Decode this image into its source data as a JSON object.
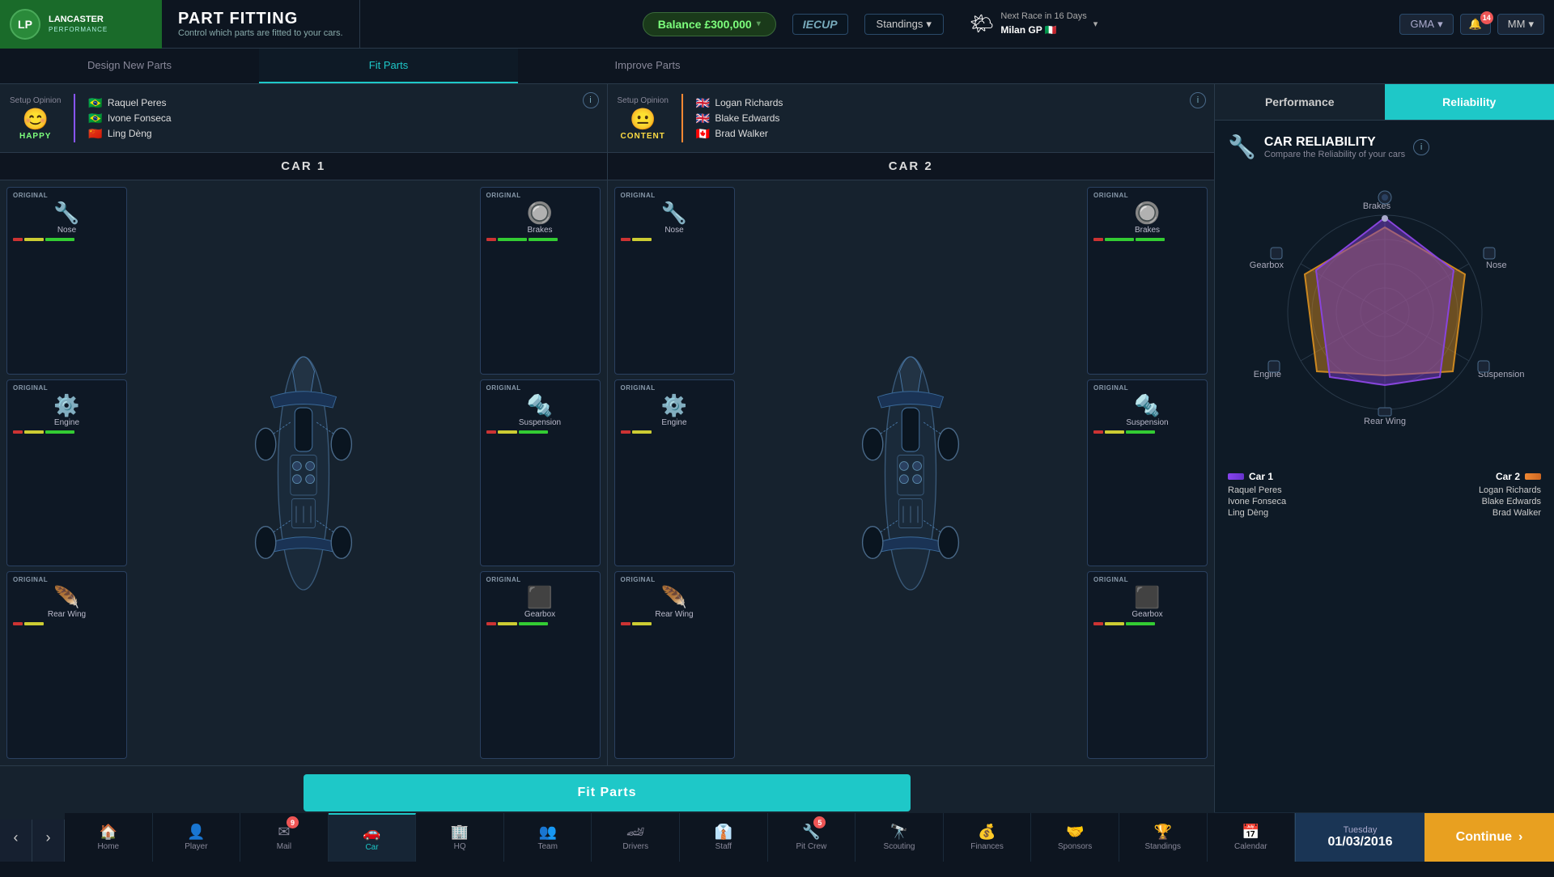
{
  "app": {
    "logo_initials": "LP",
    "logo_name": "LANCASTER",
    "logo_sub": "PERFORMANCE",
    "page_title": "PART FITTING",
    "page_subtitle": "Control which parts are fitted to your cars."
  },
  "topbar": {
    "balance_label": "Balance £300,000",
    "balance_arrow": "▾",
    "iecup": "IECUP",
    "standings": "Standings",
    "standings_arrow": "▾",
    "weather_icon": "🌤",
    "next_race_label": "Next Race in 16 Days",
    "next_race": "Milan GP 🇮🇹",
    "next_race_arrow": "▾",
    "gma": "GMA",
    "gma_arrow": "▾",
    "notif_count": "14",
    "user": "MM",
    "user_arrow": "▾"
  },
  "car1": {
    "label": "CAR 1",
    "setup_label": "Setup Opinion",
    "mood_icon": "😊",
    "mood": "HAPPY",
    "drivers": [
      {
        "flag": "🇧🇷",
        "name": "Raquel Peres"
      },
      {
        "flag": "🇧🇷",
        "name": "Ivone Fonseca"
      },
      {
        "flag": "🇨🇳",
        "name": "Ling Dèng"
      }
    ],
    "parts_left": [
      {
        "badge": "ORIGINAL",
        "icon": "🔧",
        "name": "Nose",
        "icon_char": "nose"
      },
      {
        "badge": "ORIGINAL",
        "icon": "⚙",
        "name": "Engine",
        "icon_char": "engine"
      },
      {
        "badge": "ORIGINAL",
        "icon": "🦅",
        "name": "Rear Wing",
        "icon_char": "rear_wing"
      }
    ],
    "parts_right": [
      {
        "badge": "ORIGINAL",
        "icon": "🔄",
        "name": "Brakes",
        "icon_char": "brakes"
      },
      {
        "badge": "ORIGINAL",
        "icon": "🔩",
        "name": "Suspension",
        "icon_char": "suspension"
      },
      {
        "badge": "ORIGINAL",
        "icon": "⬛",
        "name": "Gearbox",
        "icon_char": "gearbox"
      }
    ]
  },
  "car2": {
    "label": "CAR 2",
    "setup_label": "Setup Opinion",
    "mood_icon": "😐",
    "mood": "CONTENT",
    "drivers": [
      {
        "flag": "🇬🇧",
        "name": "Logan Richards"
      },
      {
        "flag": "🇬🇧",
        "name": "Blake Edwards"
      },
      {
        "flag": "🇨🇦",
        "name": "Brad Walker"
      }
    ],
    "parts_left": [
      {
        "badge": "ORIGINAL",
        "icon": "🔧",
        "name": "Nose",
        "icon_char": "nose"
      },
      {
        "badge": "ORIGINAL",
        "icon": "⚙",
        "name": "Engine",
        "icon_char": "engine"
      },
      {
        "badge": "ORIGINAL",
        "icon": "🦅",
        "name": "Rear Wing",
        "icon_char": "rear_wing"
      }
    ],
    "parts_right": [
      {
        "badge": "ORIGINAL",
        "icon": "🔄",
        "name": "Brakes",
        "icon_char": "brakes"
      },
      {
        "badge": "ORIGINAL",
        "icon": "🔩",
        "name": "Suspension",
        "icon_char": "suspension"
      },
      {
        "badge": "ORIGINAL",
        "icon": "⬛",
        "name": "Gearbox",
        "icon_char": "gearbox"
      }
    ]
  },
  "fitting_tabs": [
    {
      "label": "Design New Parts",
      "active": false
    },
    {
      "label": "Fit Parts",
      "active": true
    },
    {
      "label": "Improve Parts",
      "active": false
    }
  ],
  "fit_parts_btn": "Fit Parts",
  "right_panel": {
    "tabs": [
      {
        "label": "Performance",
        "active": false
      },
      {
        "label": "Reliability",
        "active": true
      }
    ],
    "title": "CAR RELIABILITY",
    "subtitle": "Compare the Reliability of your cars",
    "radar_labels": [
      "Brakes",
      "Nose",
      "Suspension",
      "Rear Wing",
      "Engine",
      "Gearbox"
    ],
    "car1_label": "Car 1",
    "car1_drivers": [
      "Raquel Peres",
      "Ivone Fonseca",
      "Ling Dèng"
    ],
    "car2_label": "Car 2",
    "car2_drivers": [
      "Logan Richards",
      "Blake Edwards",
      "Brad Walker"
    ]
  },
  "bottom_nav": [
    {
      "label": "Home",
      "icon": "🏠",
      "active": false,
      "badge": null
    },
    {
      "label": "Player",
      "icon": "👤",
      "active": false,
      "badge": null
    },
    {
      "label": "Mail",
      "icon": "✉",
      "active": false,
      "badge": "9"
    },
    {
      "label": "Car",
      "icon": "🚗",
      "active": true,
      "badge": null
    },
    {
      "label": "HQ",
      "icon": "🏢",
      "active": false,
      "badge": null
    },
    {
      "label": "Team",
      "icon": "👥",
      "active": false,
      "badge": null
    },
    {
      "label": "Drivers",
      "icon": "🏎",
      "active": false,
      "badge": null
    },
    {
      "label": "Staff",
      "icon": "👔",
      "active": false,
      "badge": null
    },
    {
      "label": "Pit Crew",
      "icon": "🔧",
      "active": false,
      "badge": "5"
    },
    {
      "label": "Scouting",
      "icon": "🔭",
      "active": false,
      "badge": null
    },
    {
      "label": "Finances",
      "icon": "💰",
      "active": false,
      "badge": null
    },
    {
      "label": "Sponsors",
      "icon": "🤝",
      "active": false,
      "badge": null
    },
    {
      "label": "Standings",
      "icon": "🏆",
      "active": false,
      "badge": null
    },
    {
      "label": "Calendar",
      "icon": "📅",
      "active": false,
      "badge": null
    }
  ],
  "date": {
    "day": "Tuesday",
    "date": "01/03/2016"
  },
  "continue_btn": "Continue"
}
